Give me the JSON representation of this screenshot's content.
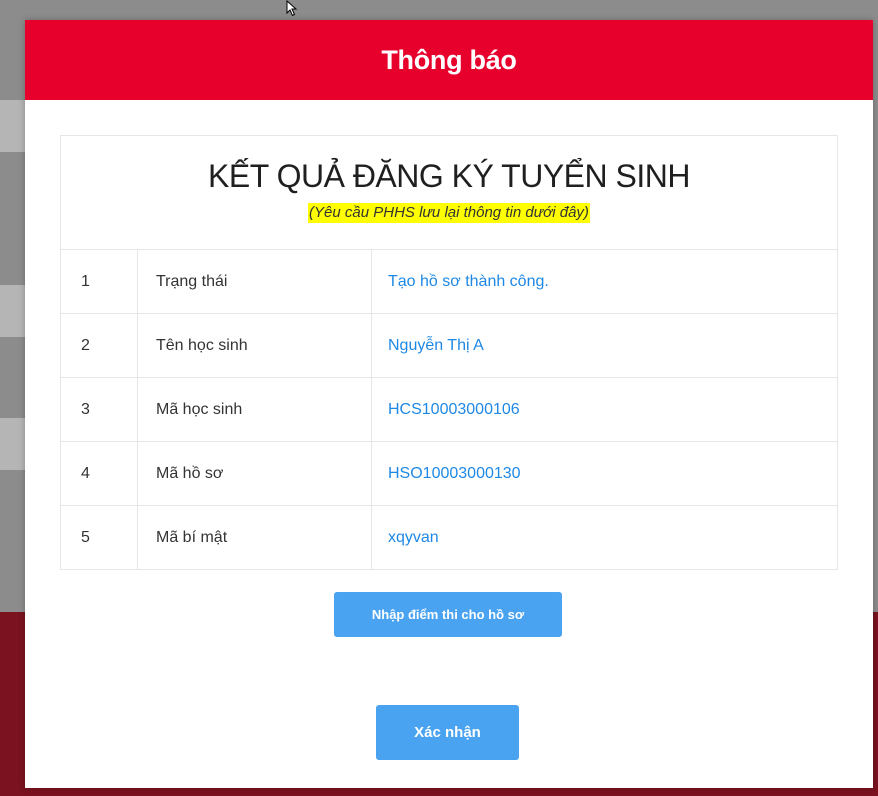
{
  "modal": {
    "title": "Thông báo"
  },
  "result": {
    "title": "KẾT QUẢ ĐĂNG KÝ TUYỂN SINH",
    "note": "(Yêu cầu PHHS lưu lại thông tin dưới đây)",
    "rows": [
      {
        "num": "1",
        "label": "Trạng thái",
        "value": "Tạo hồ sơ thành công."
      },
      {
        "num": "2",
        "label": "Tên học sinh",
        "value": "Nguyễn Thị A"
      },
      {
        "num": "3",
        "label": "Mã học sinh",
        "value": "HCS10003000106"
      },
      {
        "num": "4",
        "label": "Mã hồ sơ",
        "value": "HSO10003000130"
      },
      {
        "num": "5",
        "label": "Mã bí mật",
        "value": "xqyvan"
      }
    ]
  },
  "buttons": {
    "score_label": "Nhập điểm thi cho hồ sơ",
    "confirm_label": "Xác nhận"
  },
  "colors": {
    "header": "#e8002d",
    "button": "#4aa3f0",
    "value_text": "#1e88e5",
    "highlight": "#ffff00"
  }
}
